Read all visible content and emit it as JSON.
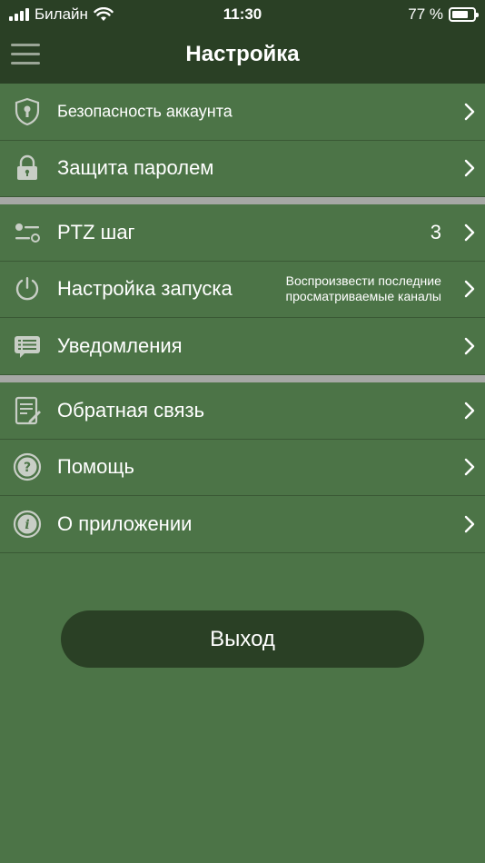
{
  "status_bar": {
    "carrier": "Билайн",
    "time": "11:30",
    "battery_text": "77 %",
    "battery_level": 0.77
  },
  "header": {
    "title": "Настройка",
    "menu_icon": "hamburger-menu-icon"
  },
  "sections": [
    {
      "items": [
        {
          "label": "Безопасность аккаунта",
          "icon": "shield-icon"
        },
        {
          "label": "Защита паролем",
          "icon": "lock-icon"
        }
      ]
    },
    {
      "items": [
        {
          "label": "PTZ шаг",
          "icon": "sliders-icon",
          "value": "3"
        },
        {
          "label": "Настройка запуска",
          "icon": "power-icon",
          "value_line1": "Воспроизвести последние",
          "value_line2": "просматриваемые каналы"
        },
        {
          "label": "Уведомления",
          "icon": "message-icon"
        }
      ]
    },
    {
      "items": [
        {
          "label": "Обратная связь",
          "icon": "feedback-icon"
        },
        {
          "label": "Помощь",
          "icon": "help-icon"
        },
        {
          "label": "О приложении",
          "icon": "info-icon"
        }
      ]
    }
  ],
  "logout_label": "Выход",
  "colors": {
    "background": "#4c7447",
    "header": "#2a4025",
    "separator": "#a6a8a5",
    "button": "#2a4025"
  }
}
